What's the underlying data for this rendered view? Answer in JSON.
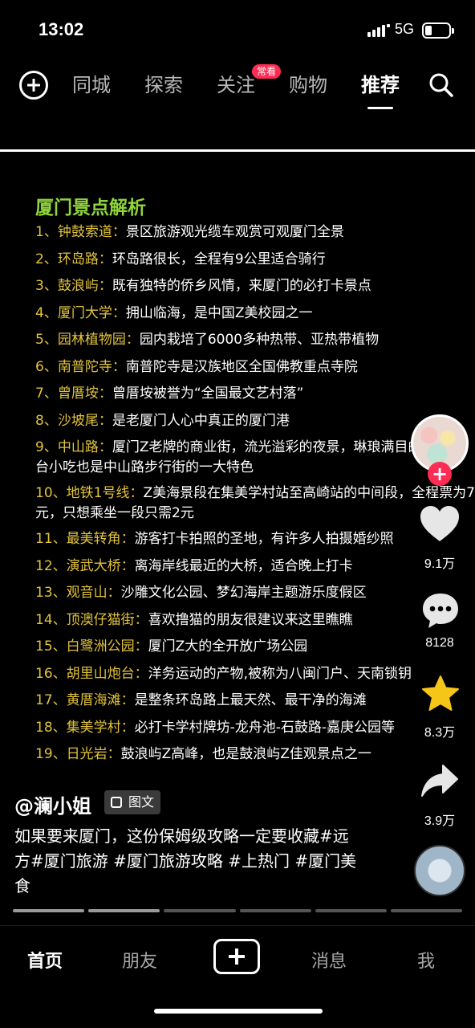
{
  "status_bar": {
    "time": "13:02",
    "network": "5G"
  },
  "top_nav": {
    "tabs": [
      {
        "label": "同城"
      },
      {
        "label": "探索"
      },
      {
        "label": "关注"
      },
      {
        "label": "购物"
      },
      {
        "label": "推荐",
        "active": true
      }
    ],
    "badge": "常看"
  },
  "post": {
    "title": "厦门景点解析",
    "items": [
      {
        "num": "1、",
        "name": "钟鼓索道",
        "sep": "：",
        "desc": "景区旅游观光缆车观赏可观厦门全景"
      },
      {
        "num": "2、",
        "name": "环岛路",
        "sep": "：",
        "desc": "环岛路很长，全程有9公里适合骑行"
      },
      {
        "num": "3、",
        "name": "鼓浪屿",
        "sep": "：",
        "desc": "既有独特的侨乡风情，来厦门的必打卡景点"
      },
      {
        "num": "4、",
        "name": "厦门大学",
        "sep": "：",
        "desc": "拥山临海，是中国Z美校园之一"
      },
      {
        "num": "5、",
        "name": "园林植物园",
        "sep": "：",
        "desc": "园内栽培了6000多种热带、亚热带植物"
      },
      {
        "num": "6、",
        "name": "南普陀寺",
        "sep": "：",
        "desc": "南普陀寺是汉族地区全国佛教重点寺院"
      },
      {
        "num": "7、",
        "name": "曾厝垵",
        "sep": "：",
        "desc": "曾厝垵被誉为“全国最文艺村落”"
      },
      {
        "num": "8、",
        "name": "沙坡尾",
        "sep": "：",
        "desc": "是老厦门人心中真正的厦门港"
      },
      {
        "num": "9、",
        "name": "中山路",
        "sep": "：",
        "desc": "厦门Z老牌的商业街，流光溢彩的夜景，琳琅满目的各色闽台小吃也是中山路步行街的一大特色"
      },
      {
        "num": "10、",
        "name": "地铁1号线",
        "sep": "：",
        "desc": "Z美海景段在集美学村站至高崎站的中间段，全程票为7元，只想乘坐一段只需2元"
      },
      {
        "num": "11、",
        "name": "最美转角",
        "sep": "：",
        "desc": "游客打卡拍照的圣地，有许多人拍摄婚纱照"
      },
      {
        "num": "12、",
        "name": "演武大桥",
        "sep": "：",
        "desc": "离海岸线最近的大桥，适合晚上打卡"
      },
      {
        "num": "13、",
        "name": "观音山",
        "sep": "：",
        "desc": "沙雕文化公园、梦幻海岸主题游乐度假区"
      },
      {
        "num": "14、",
        "name": "顶澳仔猫街",
        "sep": "：",
        "desc": "喜欢撸猫的朋友很建议来这里瞧瞧"
      },
      {
        "num": "15、",
        "name": "白鹭洲公园",
        "sep": "：",
        "desc": "厦门Z大的全开放广场公园"
      },
      {
        "num": "16、",
        "name": "胡里山炮台",
        "sep": "：",
        "desc": "洋务运动的产物,被称为八闽门户、天南锁钥"
      },
      {
        "num": "17、",
        "name": "黄厝海滩",
        "sep": "：",
        "desc": "是整条环岛路上最天然、最干净的海滩"
      },
      {
        "num": "18、",
        "name": "集美学村",
        "sep": "：",
        "desc": "必打卡学村牌坊-龙舟池-石鼓路-嘉庚公园等"
      },
      {
        "num": "19、",
        "name": "日光岩",
        "sep": "：",
        "desc": "鼓浪屿Z高峰，也是鼓浪屿Z佳观景点之一"
      }
    ]
  },
  "actions": {
    "likes": "9.1万",
    "comments": "8128",
    "favorites": "8.3万",
    "shares": "3.9万"
  },
  "caption": {
    "author": "@澜小姐",
    "type_label": "图文",
    "text": "如果要来厦门，这份保姆级攻略一定要收藏#远方#厦门旅游 #厦门旅游攻略 #上热门 #厦门美食"
  },
  "progress": {
    "segments_total": 6,
    "segments_viewed": 2
  },
  "bottom_nav": {
    "home": "首页",
    "friends": "朋友",
    "messages": "消息",
    "me": "我"
  },
  "colors": {
    "title_green": "#8fd43a",
    "item_gold": "#e2c33b",
    "accent_red": "#fe2c55",
    "favorite_yellow": "#f5c518"
  }
}
